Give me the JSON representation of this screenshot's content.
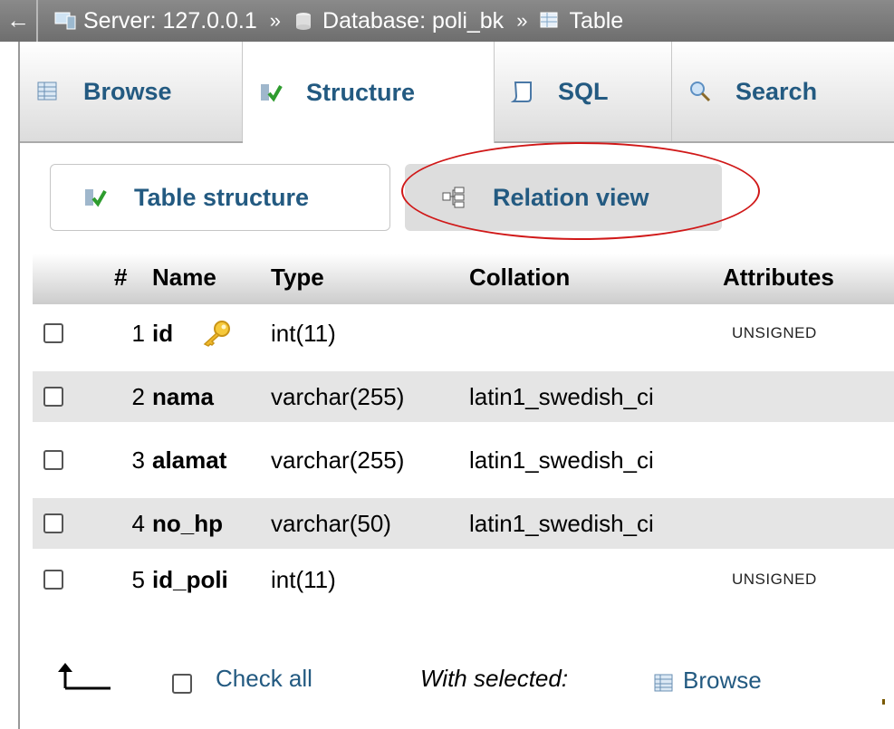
{
  "breadcrumb": {
    "back_icon": "←",
    "items": [
      {
        "label": "Server: 127.0.0.1",
        "icon": "server-icon"
      },
      {
        "label": "Database: poli_bk",
        "icon": "database-icon"
      },
      {
        "label": "Table",
        "icon": "table-icon"
      }
    ],
    "separator": "»"
  },
  "tabs": [
    {
      "label": "Browse",
      "icon": "browse-icon",
      "active": false
    },
    {
      "label": "Structure",
      "icon": "structure-icon",
      "active": true
    },
    {
      "label": "SQL",
      "icon": "sql-icon",
      "active": false
    },
    {
      "label": "Search",
      "icon": "search-icon",
      "active": false
    }
  ],
  "subtabs": [
    {
      "label": "Table structure",
      "icon": "structure-icon"
    },
    {
      "label": "Relation view",
      "icon": "relation-icon"
    }
  ],
  "table": {
    "columns": [
      "#",
      "Name",
      "Type",
      "Collation",
      "Attributes"
    ],
    "rows": [
      {
        "num": "1",
        "name": "id",
        "type": "int(11)",
        "collation": "",
        "attributes": "UNSIGNED",
        "primary_key": true
      },
      {
        "num": "2",
        "name": "nama",
        "type": "varchar(255)",
        "collation": "latin1_swedish_ci",
        "attributes": ""
      },
      {
        "num": "3",
        "name": "alamat",
        "type": "varchar(255)",
        "collation": "latin1_swedish_ci",
        "attributes": ""
      },
      {
        "num": "4",
        "name": "no_hp",
        "type": "varchar(50)",
        "collation": "latin1_swedish_ci",
        "attributes": ""
      },
      {
        "num": "5",
        "name": "id_poli",
        "type": "int(11)",
        "collation": "",
        "attributes": "UNSIGNED"
      }
    ]
  },
  "footer": {
    "check_all": "Check all",
    "with_selected": "With selected:",
    "browse": "Browse"
  },
  "colors": {
    "link": "#235a81",
    "highlight_ellipse": "#d01818",
    "row_alt": "#e5e5e5"
  }
}
